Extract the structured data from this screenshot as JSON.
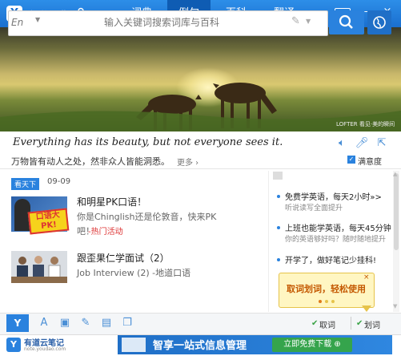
{
  "titlebar": {
    "app_title": "有道词典",
    "tabs": [
      {
        "label": "词典",
        "active": false
      },
      {
        "label": "例句",
        "active": true
      },
      {
        "label": "百科",
        "active": false
      },
      {
        "label": "翻译",
        "active": false
      }
    ],
    "mini_label": "mini",
    "minimize": "–",
    "close": "×"
  },
  "search": {
    "language": "En",
    "placeholder": "输入关键词搜索词库与百科"
  },
  "hero": {
    "watermark": "LOFTER 看见·美的瞬间"
  },
  "sentence": {
    "english": "Everything has its beauty, but not everyone sees it.",
    "chinese": "万物皆有动人之处，然非众人皆能洞悉。",
    "more": "更多 ›",
    "satisfaction_label": "满意度"
  },
  "feed": {
    "badge": "看天下",
    "date": "09-09",
    "items": [
      {
        "title": "和明星PK口语！",
        "subtitle": "你是Chinglish还是伦敦音，快来PK",
        "subtitle_cont": "吧！",
        "tag": "-热门活动",
        "thumb_text": "口语大PK!"
      },
      {
        "title": "跟歪果仁学面试（2）",
        "subtitle": "Job Interview (2) -地道口语"
      }
    ]
  },
  "right_panel": {
    "items": [
      {
        "title": "免费学英语，每天2小时»>",
        "sub": "听说读写全面提升"
      },
      {
        "title": "上班也能学英语，每天45分钟",
        "sub": "你的英语够好吗？随时随地提升"
      },
      {
        "title": "开学了，做好笔记少挂科!",
        "sub": ""
      }
    ]
  },
  "tooltip": {
    "text": "取词划词，轻松使用",
    "close": "×"
  },
  "toolbar": {
    "quci": "取词",
    "huaci": "划词",
    "check": "✔"
  },
  "ad": {
    "note_name": "有道云笔记",
    "note_url": "note.youdao.com",
    "banner_text": "智享一站式信息管理",
    "banner_button": "立即免费下载 ⊕"
  },
  "colors": {
    "brand_blue": "#2a82de",
    "hot_red": "#dd3333",
    "download_green": "#35a44c"
  }
}
